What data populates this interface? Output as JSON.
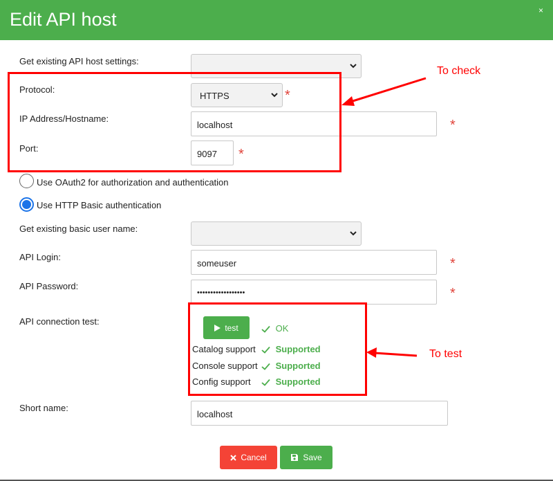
{
  "dialog": {
    "title": "Edit API host",
    "close_label": "×"
  },
  "form": {
    "existing_settings_label": "Get existing API host settings:",
    "existing_settings_value": "",
    "protocol_label": "Protocol:",
    "protocol_value": "HTTPS",
    "host_label": "IP Address/Hostname:",
    "host_value": "localhost",
    "port_label": "Port:",
    "port_value": "9097",
    "required_mark": "*",
    "oauth_label": "Use OAuth2 for authorization and authentication",
    "basic_label": "Use HTTP Basic authentication",
    "existing_user_label": "Get existing basic user name:",
    "existing_user_value": "",
    "login_label": "API Login:",
    "login_value": "someuser",
    "password_label": "API Password:",
    "password_value": "••••••••••••••••••",
    "connection_test_label": "API connection test:",
    "test_button_label": "test",
    "test_result": "OK",
    "support": [
      {
        "label": "Catalog support",
        "value": "Supported"
      },
      {
        "label": "Console support",
        "value": "Supported"
      },
      {
        "label": "Config support",
        "value": "Supported"
      }
    ],
    "short_name_label": "Short name:",
    "short_name_value": "localhost"
  },
  "buttons": {
    "cancel_label": "Cancel",
    "save_label": "Save"
  },
  "annotations": {
    "to_check": "To check",
    "to_test": "To test"
  },
  "colors": {
    "header": "#4cae4c",
    "success": "#4cae4c",
    "danger": "#f44336",
    "radio_accent": "#1a73e8",
    "annotation": "#ff0000"
  }
}
